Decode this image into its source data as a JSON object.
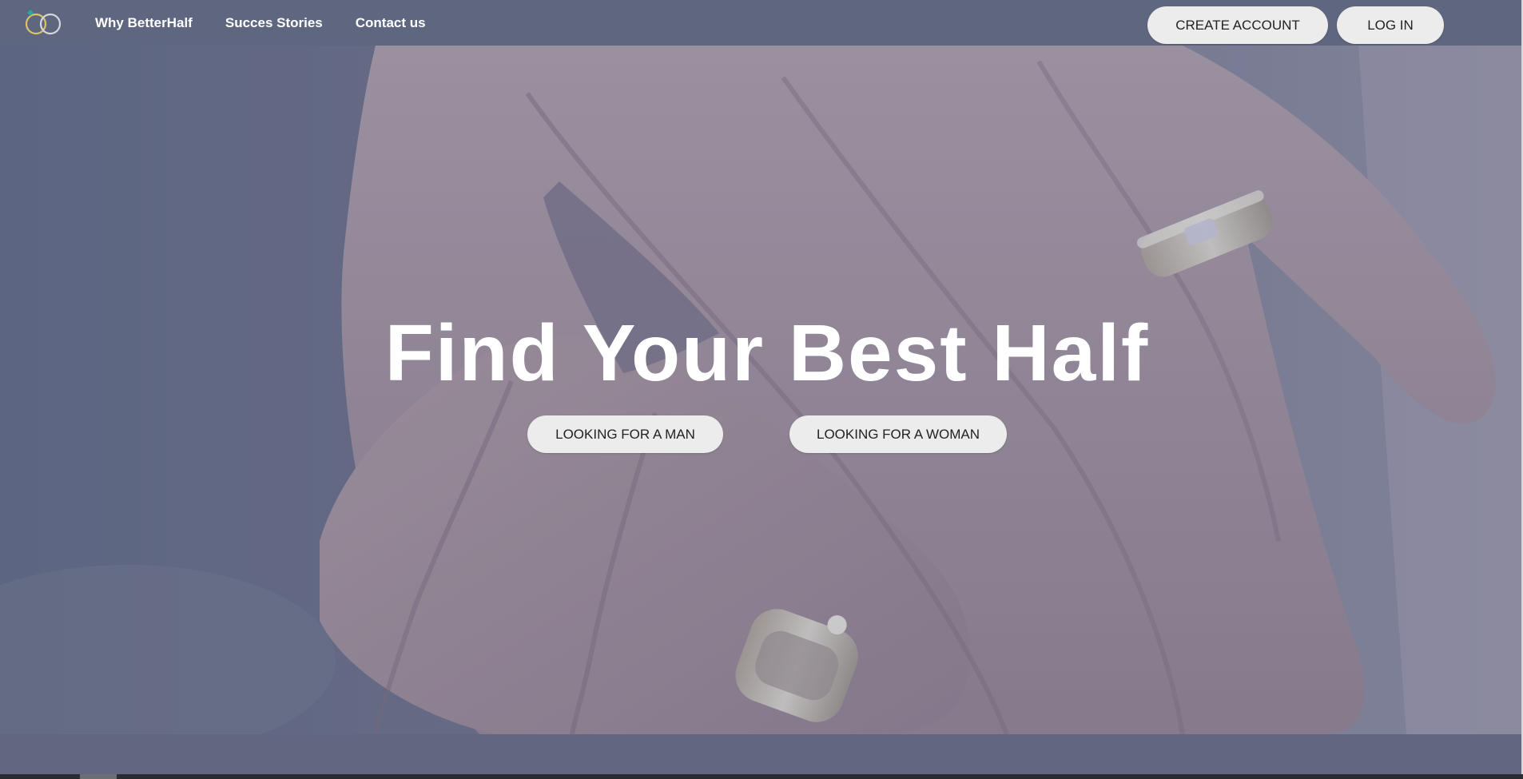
{
  "nav": {
    "links": [
      "Why BetterHalf",
      "Succes Stories",
      "Contact us"
    ],
    "create_account": "CREATE ACCOUNT",
    "log_in": "LOG IN"
  },
  "hero": {
    "headline": "Find Your Best Half",
    "cta_man": "LOOKING FOR A MAN",
    "cta_woman": "LOOKING FOR A WOMAN"
  },
  "colors": {
    "nav_bg": "#5f6680",
    "button_bg": "#ececec",
    "logo_gold": "#d9c36a",
    "logo_teal": "#2aa6a0"
  },
  "icons": [
    "logo-rings-icon"
  ]
}
